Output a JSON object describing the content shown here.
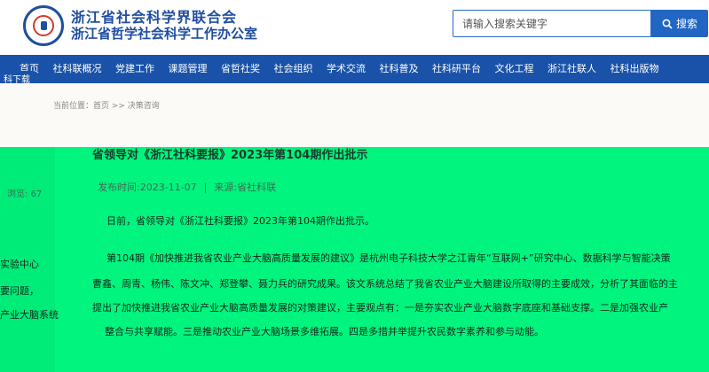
{
  "header": {
    "org_title": "浙江省社会科学界联合会",
    "org_subtitle": "浙江省哲学社会科学工作办公室",
    "search_placeholder": "请输入搜索关键字",
    "search_button": "搜索"
  },
  "nav": {
    "items": [
      "首页",
      "社科联概况",
      "党建工作",
      "课题管理",
      "省哲社奖",
      "社会组织",
      "学术交流",
      "社科普及",
      "社科研平台",
      "文化工程",
      "浙江社联人",
      "社科出版物"
    ],
    "extra": "科下载"
  },
  "breadcrumb": "当前位置：首页 >> 决策咨询",
  "article": {
    "title": "省领导对《浙江社科要报》2023年第104期作出批示",
    "publish_time": "发布时间:2023-11-07",
    "source": "来源:省社科联",
    "views": "浏览: 67",
    "para1": "日前，省领导对《浙江社科要报》2023年第104期作出批示。",
    "para2": "第104期《加快推进我省农业产业大脑高质量发展的建议》是杭州电子科技大学之江青年“互联网+”研究中心、数据科学与智能决策",
    "para3": "曹鑫、周青、杨伟、陈文冲、郑登攀、聂力兵的研究成果。该文系统总结了我省农业产业大脑建设所取得的主要成效，分析了其面临的主",
    "para4": "提出了加快推进我省农业产业大脑高质量发展的对策建议，主要观点有：一是夯实农业产业大脑数字底座和基础支撑。二是加强农业产",
    "para5": "整合与共享赋能。三是推动农业产业大脑场景多维拓展。四是多措并举提升农民数字素养和参与动能。"
  },
  "side_fragments": [
    "实验中心",
    "要问题，",
    "产业大脑系统"
  ]
}
